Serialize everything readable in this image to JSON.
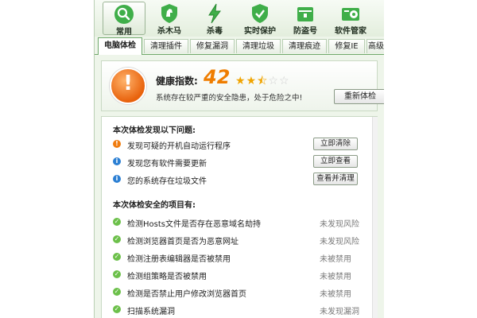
{
  "toolbar": [
    {
      "label": "常用",
      "icon": "magnifier-icon",
      "active": true
    },
    {
      "label": "杀木马",
      "icon": "horse-shield-icon",
      "active": false
    },
    {
      "label": "杀毒",
      "icon": "lightning-icon",
      "active": false
    },
    {
      "label": "实时保护",
      "icon": "shield-check-icon",
      "active": false
    },
    {
      "label": "防盗号",
      "icon": "safe-box-icon",
      "active": false
    },
    {
      "label": "软件管家",
      "icon": "software-box-icon",
      "active": false
    }
  ],
  "tabs": [
    {
      "label": "电脑体检",
      "active": true
    },
    {
      "label": "清理插件"
    },
    {
      "label": "修复漏洞"
    },
    {
      "label": "清理垃圾"
    },
    {
      "label": "清理痕迹"
    },
    {
      "label": "修复IE"
    },
    {
      "label": "高级"
    }
  ],
  "health": {
    "label": "健康指数:",
    "score": "42",
    "rating_stars": 2.5,
    "rating_max": 5,
    "description": "系统存在较严重的安全隐患，处于危险之中!",
    "recheck_label": "重新体检",
    "warning_symbol": "!"
  },
  "problems": {
    "title": "本次体检发现以下问题:",
    "items": [
      {
        "text": "发现可疑的开机自动运行程序",
        "button": "立即清除",
        "icon": "warning-icon",
        "color": "#f07c0f"
      },
      {
        "text": "发现您有软件需要更新",
        "button": "立即查看",
        "icon": "info-icon",
        "color": "#2b7fd3"
      },
      {
        "text": "您的系统存在垃圾文件",
        "button": "查看并清理",
        "icon": "info-icon",
        "color": "#2b7fd3"
      }
    ]
  },
  "safe": {
    "title": "本次体检安全的项目有:",
    "items": [
      {
        "text": "检测Hosts文件是否存在恶意域名劫持",
        "status": "未发现风险"
      },
      {
        "text": "检测浏览器首页是否为恶意网址",
        "status": "未发现风险"
      },
      {
        "text": "检测注册表编辑器是否被禁用",
        "status": "未被禁用"
      },
      {
        "text": "检测组策略是否被禁用",
        "status": "未被禁用"
      },
      {
        "text": "检测是否禁止用户修改浏览器首页",
        "status": "未被禁用"
      },
      {
        "text": "扫描系统漏洞",
        "status": "未发现漏洞"
      }
    ]
  },
  "colors": {
    "accent_green": "#6fa86a",
    "score_orange": "#ef7d00",
    "star_gold": "#f0a400",
    "safe_green": "#6cc04a"
  }
}
